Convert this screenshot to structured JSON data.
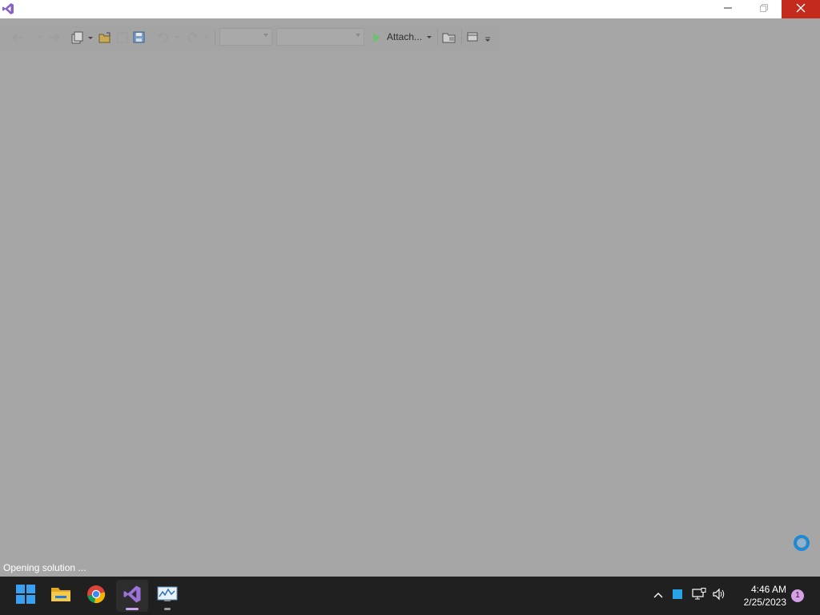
{
  "window": {
    "logo_icon": "visual-studio-logo-icon",
    "controls": {
      "minimize_icon": "minimize-icon",
      "maximize_icon": "restore-icon",
      "close_icon": "close-icon"
    }
  },
  "toolbar": {
    "attach_label": "Attach...",
    "icons": [
      "back-icon",
      "forward-icon",
      "new-project-icon",
      "open-file-icon",
      "save-icon",
      "save-all-icon",
      "undo-icon",
      "redo-icon",
      "start-icon",
      "solution-explorer-icon",
      "window-layout-icon"
    ]
  },
  "status_bar": {
    "text": "Opening solution ..."
  },
  "taskbar": {
    "apps": [
      {
        "name": "start",
        "icon": "windows-start-icon"
      },
      {
        "name": "file-explorer",
        "icon": "folder-icon"
      },
      {
        "name": "chrome",
        "icon": "chrome-icon"
      },
      {
        "name": "visual-studio",
        "icon": "visual-studio-icon",
        "active": true
      },
      {
        "name": "performance-monitor",
        "icon": "monitor-chart-icon"
      }
    ],
    "tray": {
      "chevron_icon": "chevron-up-icon",
      "app_icon": "blue-square-icon",
      "network_icon": "network-icon",
      "volume_icon": "volume-icon"
    },
    "clock": {
      "time": "4:46 AM",
      "date": "2/25/2023"
    },
    "notification_count": "1"
  },
  "colors": {
    "accent": "#c42b1c",
    "vs_purple": "#8661c5",
    "overlay": "#a6a6a6",
    "taskbar": "#202020"
  }
}
